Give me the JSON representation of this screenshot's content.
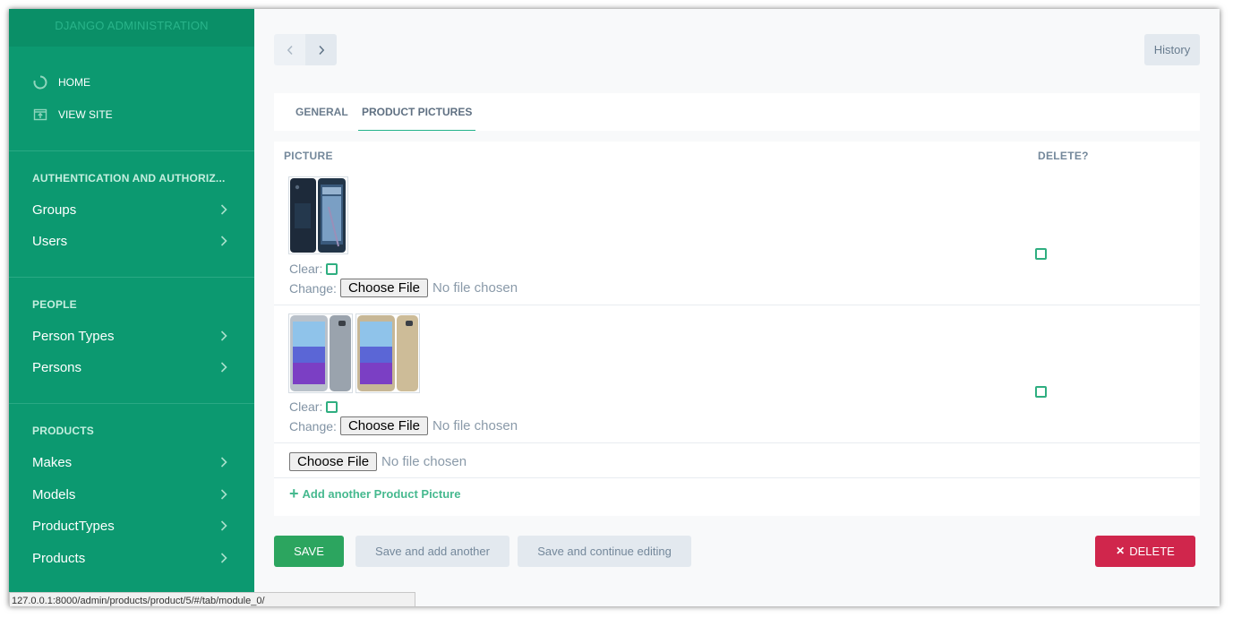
{
  "sidebar": {
    "brand": "DJANGO ADMINISTRATION",
    "home_label": "HOME",
    "view_site_label": "VIEW SITE",
    "sections": [
      {
        "title": "AUTHENTICATION AND AUTHORIZ...",
        "items": [
          "Groups",
          "Users"
        ]
      },
      {
        "title": "PEOPLE",
        "items": [
          "Person Types",
          "Persons"
        ]
      },
      {
        "title": "PRODUCTS",
        "items": [
          "Makes",
          "Models",
          "ProductTypes",
          "Products"
        ]
      }
    ]
  },
  "toolbar": {
    "history_label": "History"
  },
  "tabs": [
    {
      "label": "GENERAL",
      "active": false
    },
    {
      "label": "PRODUCT PICTURES",
      "active": true
    }
  ],
  "inline": {
    "columns": [
      "PICTURE",
      "DELETE?"
    ],
    "clear_label": "Clear:",
    "change_label": "Change:",
    "choose_file_label": "Choose File",
    "no_file_label": "No file chosen",
    "rows": [
      {
        "image": "black-smartphone-thumbnail"
      },
      {
        "image": "silver-and-gold-smartphones-thumbnail"
      }
    ],
    "add_another_label": "Add another Product Picture"
  },
  "actions": {
    "save_label": "SAVE",
    "save_add_label": "Save and add another",
    "save_continue_label": "Save and continue editing",
    "delete_label": "DELETE"
  },
  "status_url": "127.0.0.1:8000/admin/products/product/5/#/tab/module_0/",
  "colors": {
    "sidebar": "#0c9970",
    "accent": "#24b38b",
    "save": "#2ca55f",
    "delete": "#d0264c"
  }
}
